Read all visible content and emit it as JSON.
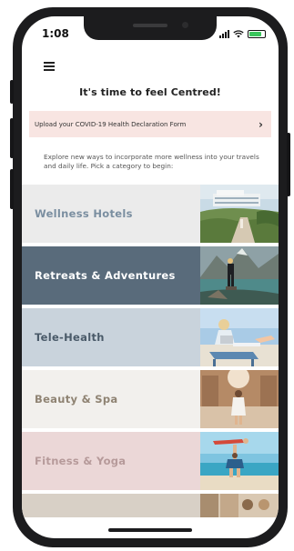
{
  "status_bar": {
    "time": "1:08"
  },
  "header": {
    "heading": "It's time to feel Centred!"
  },
  "banner": {
    "label": "Upload your COVID-19 Health Declaration Form",
    "chevron": "›"
  },
  "intro_text": "Explore new ways to incorporate more wellness into your travels and daily life. Pick a category to begin:",
  "categories": [
    {
      "label": "Wellness Hotels",
      "bg": "#ebebeb",
      "color": "#7a8ea0",
      "photo": "hotel-resort-photo"
    },
    {
      "label": "Retreats & Adventures",
      "bg": "#596b7b",
      "color": "#ffffff",
      "photo": "mountain-lake-photo"
    },
    {
      "label": "Tele-Health",
      "bg": "#c9d3dc",
      "color": "#4a5a69",
      "photo": "laptop-beach-photo"
    },
    {
      "label": "Beauty & Spa",
      "bg": "#f2f0ed",
      "color": "#8f8373",
      "photo": "spa-photo"
    },
    {
      "label": "Fitness & Yoga",
      "bg": "#ebd7d7",
      "color": "#b69a9a",
      "photo": "beach-yoga-photo"
    }
  ],
  "colors": {
    "banner_bg": "#f8e5e2",
    "battery": "#39c55b",
    "frame": "#1c1c1e"
  }
}
